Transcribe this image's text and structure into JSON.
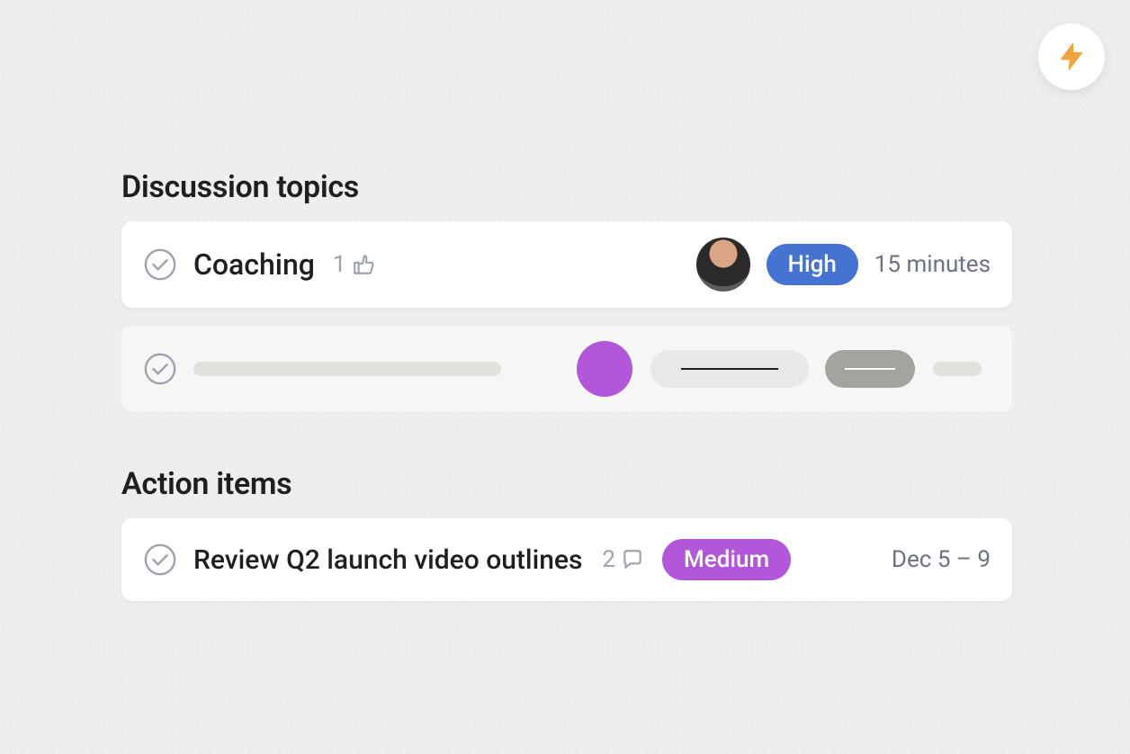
{
  "lightning_icon": "lightning",
  "sections": {
    "discussion": {
      "title": "Discussion topics",
      "items": [
        {
          "title": "Coaching",
          "likes": "1",
          "assignee": "user-avatar",
          "priority": {
            "label": "High",
            "color": "#4573d2"
          },
          "duration": "15 minutes"
        },
        {
          "placeholder": true,
          "assignee_color": "#b257d9"
        }
      ]
    },
    "action": {
      "title": "Action items",
      "items": [
        {
          "title": "Review Q2 launch video outlines",
          "comments": "2",
          "priority": {
            "label": "Medium",
            "color": "#b257d9"
          },
          "dates": "Dec 5 – 9"
        }
      ]
    }
  }
}
